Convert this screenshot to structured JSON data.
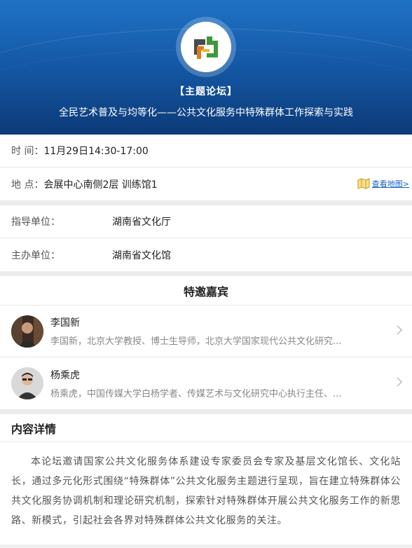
{
  "header": {
    "tag": "【主题论坛】",
    "title": "全民艺术普及与均等化——公共文化服务中特殊群体工作探索与实践",
    "logo_icon": "cultural-logo-icon",
    "colors": {
      "top": "#1f72c6",
      "bottom": "#0c3a78"
    }
  },
  "info": {
    "time_label": "时 间：",
    "time_value": "11月29日14:30-17:00",
    "place_label": "地 点：",
    "place_value": "会展中心南侧2层 训练馆1",
    "map_link": "查看地图>",
    "map_icon": "map-icon"
  },
  "orgs": {
    "guide_label": "指导单位：",
    "guide_value": "湖南省文化厅",
    "host_label": "主办单位：",
    "host_value": "湖南省文化馆"
  },
  "guests": {
    "heading": "特邀嘉宾",
    "items": [
      {
        "name": "李国新",
        "desc": "李国新，北京大学教授、博士生导师，北京大学国家现代公共文化研究..."
      },
      {
        "name": "杨乘虎",
        "desc": "杨乘虎，中国传媒大学白杨学者、传媒艺术与文化研究中心执行主任、..."
      }
    ]
  },
  "detail": {
    "heading": "内容详情",
    "body": "本论坛邀请国家公共文化服务体系建设专家委员会专家及基层文化馆长、文化站长，通过多元化形式围绕“特殊群体”公共文化服务主题进行呈现，旨在建立特殊群体公共文化服务协调机制和理论研究机制，探索针对特殊群体开展公共文化服务工作的新思路、新模式，引起社会各界对特殊群体公共文化服务的关注。"
  }
}
